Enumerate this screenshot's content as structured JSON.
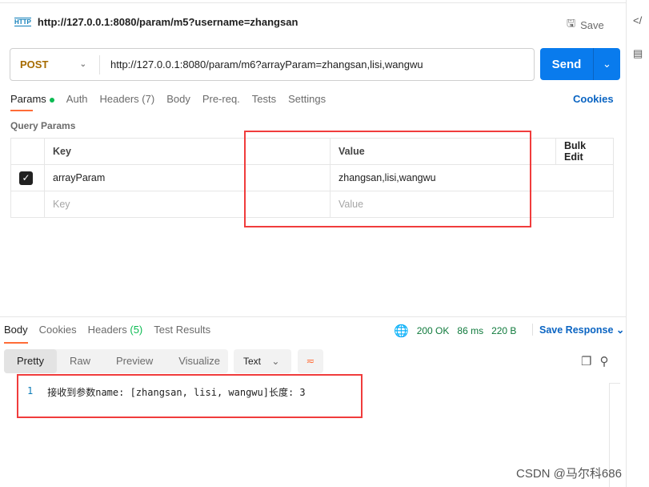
{
  "header": {
    "title": "http://127.0.0.1:8080/param/m5?username=zhangsan",
    "save_label": "Save",
    "http_icon": "HTTP"
  },
  "request": {
    "method": "POST",
    "url": "http://127.0.0.1:8080/param/m6?arrayParam=zhangsan,lisi,wangwu",
    "send_label": "Send"
  },
  "tabs": [
    {
      "label": "Params"
    },
    {
      "label": "Auth"
    },
    {
      "label": "Headers (7)"
    },
    {
      "label": "Body"
    },
    {
      "label": "Pre-req."
    },
    {
      "label": "Tests"
    },
    {
      "label": "Settings"
    }
  ],
  "cookies_label": "Cookies",
  "query_params": {
    "title": "Query Params",
    "headers": {
      "key": "Key",
      "value": "Value",
      "bulk": "Bulk Edit"
    },
    "rows": [
      {
        "key": "arrayParam",
        "value": "zhangsan,lisi,wangwu",
        "checked": true
      }
    ],
    "placeholder": {
      "key": "Key",
      "value": "Value"
    }
  },
  "response": {
    "tabs": [
      {
        "label": "Body"
      },
      {
        "label": "Cookies"
      },
      {
        "label": "Headers"
      },
      {
        "label": "Test Results"
      }
    ],
    "headers_count": "(5)",
    "status": "200 OK",
    "time": "86 ms",
    "size": "220 B",
    "save_response": "Save Response",
    "views": [
      {
        "label": "Pretty"
      },
      {
        "label": "Raw"
      },
      {
        "label": "Preview"
      },
      {
        "label": "Visualize"
      }
    ],
    "format": "Text",
    "line_number": "1",
    "body": "接收到参数name: [zhangsan, lisi, wangwu]长度: 3"
  },
  "watermark": "CSDN @马尔科686",
  "colors": {
    "accent": "#ff6c37",
    "send": "#097bed",
    "highlight": "#f03c3c"
  }
}
